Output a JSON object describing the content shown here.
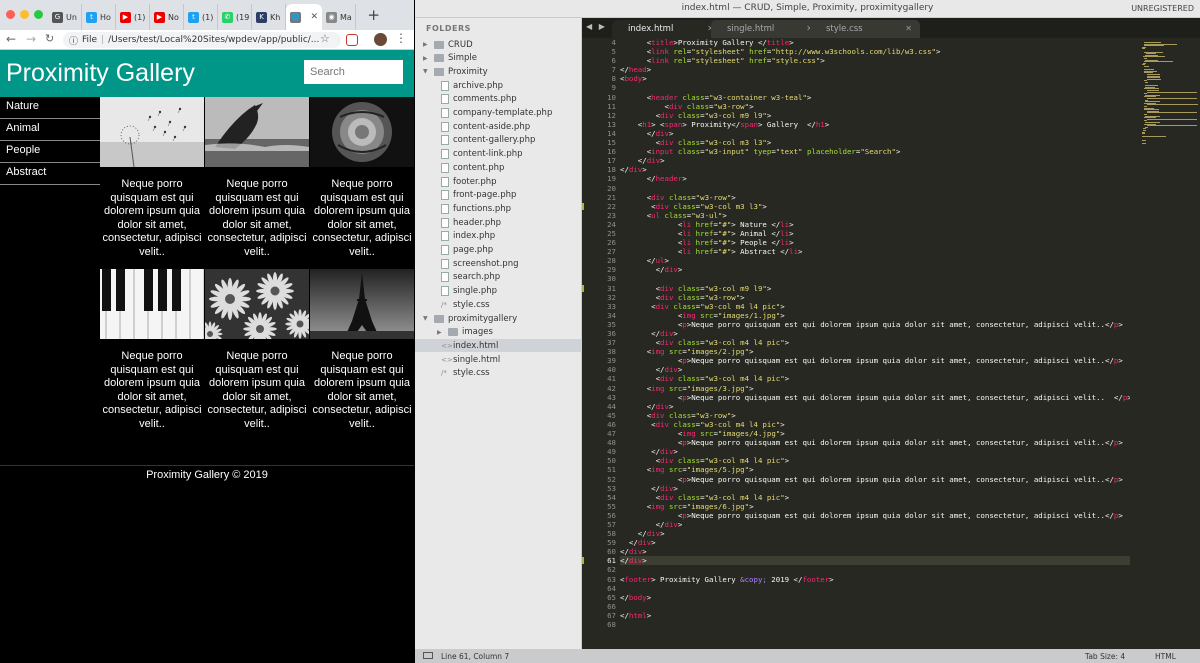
{
  "browser": {
    "tabs": [
      {
        "label": "Un",
        "icon": "G",
        "color": "#555"
      },
      {
        "label": "Ho",
        "icon": "t",
        "color": "#1da1f2"
      },
      {
        "label": "(1)",
        "icon": "▶",
        "color": "#e00"
      },
      {
        "label": "No",
        "icon": "▶",
        "color": "#e00"
      },
      {
        "label": "(1)",
        "icon": "t",
        "color": "#1da1f2"
      },
      {
        "label": "(19",
        "icon": "✆",
        "color": "#25d366"
      },
      {
        "label": "Kh",
        "icon": "K",
        "color": "#2b3e66"
      }
    ],
    "active_tab_icon": "globe-icon",
    "last_tab": {
      "label": "Ma",
      "icon": "◉",
      "color": "#888"
    },
    "new_tab": "+",
    "address_scheme": "File",
    "address": "/Users/test/Local%20Sites/wpdev/app/public/..."
  },
  "site": {
    "title": "Proximity Gallery",
    "search_placeholder": "Search",
    "nav": [
      "Nature",
      "Animal",
      "People",
      "Abstract"
    ],
    "caption": "Neque porro quisquam est qui dolorem ipsum quia dolor sit amet, consectetur, adipisci velit..",
    "images": [
      "dandelion",
      "dolphin",
      "rose",
      "piano",
      "daisies",
      "eiffel-tower"
    ],
    "footer": "Proximity Gallery © 2019"
  },
  "editor": {
    "title": "index.html — CRUD, Simple, Proximity, proximitygallery",
    "unregistered": "UNREGISTERED",
    "folders_label": "FOLDERS",
    "tree": [
      {
        "type": "folder",
        "label": "CRUD",
        "open": false,
        "depth": 0
      },
      {
        "type": "folder",
        "label": "Simple",
        "open": false,
        "depth": 0
      },
      {
        "type": "folder",
        "label": "Proximity",
        "open": true,
        "depth": 0
      },
      {
        "type": "file",
        "label": "archive.php",
        "depth": 1
      },
      {
        "type": "file",
        "label": "comments.php",
        "depth": 1
      },
      {
        "type": "file",
        "label": "company-template.php",
        "depth": 1
      },
      {
        "type": "file",
        "label": "content-aside.php",
        "depth": 1
      },
      {
        "type": "file",
        "label": "content-gallery.php",
        "depth": 1
      },
      {
        "type": "file",
        "label": "content-link.php",
        "depth": 1
      },
      {
        "type": "file",
        "label": "content.php",
        "depth": 1
      },
      {
        "type": "file",
        "label": "footer.php",
        "depth": 1
      },
      {
        "type": "file",
        "label": "front-page.php",
        "depth": 1
      },
      {
        "type": "file",
        "label": "functions.php",
        "depth": 1
      },
      {
        "type": "file",
        "label": "header.php",
        "depth": 1
      },
      {
        "type": "file",
        "label": "index.php",
        "depth": 1
      },
      {
        "type": "file",
        "label": "page.php",
        "depth": 1
      },
      {
        "type": "file",
        "label": "screenshot.png",
        "depth": 1
      },
      {
        "type": "file",
        "label": "search.php",
        "depth": 1
      },
      {
        "type": "file",
        "label": "single.php",
        "depth": 1
      },
      {
        "type": "css",
        "label": "style.css",
        "depth": 1
      },
      {
        "type": "folder",
        "label": "proximitygallery",
        "open": true,
        "depth": 0
      },
      {
        "type": "folder",
        "label": "images",
        "open": false,
        "depth": 1
      },
      {
        "type": "html",
        "label": "index.html",
        "depth": 1,
        "selected": true
      },
      {
        "type": "html",
        "label": "single.html",
        "depth": 1
      },
      {
        "type": "css",
        "label": "style.css",
        "depth": 1
      }
    ],
    "tabs": [
      {
        "label": "index.html",
        "active": true
      },
      {
        "label": "single.html",
        "active": false
      },
      {
        "label": "style.css",
        "active": false
      }
    ],
    "first_line_number": 4,
    "current_line": 61,
    "modified_lines": [
      22,
      31,
      61
    ],
    "code_lines": [
      "      <title>Proximity Gallery </title>",
      "      <link rel=\"stylesheet\" href=\"http://www.w3schools.com/lib/w3.css\">",
      "      <link rel=\"stylesheet\" href=\"style.css\">",
      "</head>",
      "<body>",
      "",
      "      <header class=\"w3-container w3-teal\">",
      "          <div class=\"w3-row\">",
      "        <div class=\"w3-col m9 l9\">",
      "    <h1> <span> Proximity</span> Gallery  </h1>",
      "      </div>",
      "        <div class=\"w3-col m3 l3\">",
      "      <input class=\"w3-input\" tyep=\"text\" placeholder=\"Search\">",
      "    </div>",
      "</div>",
      "      </header>",
      "",
      "      <div class=\"w3-row\">",
      "       <div class=\"w3-col m3 l3\">",
      "      <ul class=\"w3-ul\">",
      "             <li href=\"#\"> Nature </li>",
      "             <li href=\"#\"> Animal </li>",
      "             <li href=\"#\"> People </li>",
      "             <li href=\"#\"> Abstract </li>",
      "      </ul>",
      "        </div>",
      "",
      "        <div class=\"w3-col m9 l9\">",
      "        <div class=\"w3-row\">",
      "       <div class=\"w3-col m4 l4 pic\">",
      "             <img src=\"images/1.jpg\">",
      "             <p>Neque porro quisquam est qui dolorem ipsum quia dolor sit amet, consectetur, adipisci velit..</p>",
      "       </div>",
      "        <div class=\"w3-col m4 l4 pic\">",
      "      <img src=\"images/2.jpg\">",
      "             <p>Neque porro quisquam est qui dolorem ipsum quia dolor sit amet, consectetur, adipisci velit..</p>",
      "        </div>",
      "        <div class=\"w3-col m4 l4 pic\">",
      "      <img src=\"images/3.jpg\">",
      "             <p>Neque porro quisquam est qui dolorem ipsum quia dolor sit amet, consectetur, adipisci velit..  </p>",
      "      </div>",
      "      <div class=\"w3-row\">",
      "       <div class=\"w3-col m4 l4 pic\">",
      "             <img src=\"images/4.jpg\">",
      "             <p>Neque porro quisquam est qui dolorem ipsum quia dolor sit amet, consectetur, adipisci velit..</p>",
      "       </div>",
      "        <div class=\"w3-col m4 l4 pic\">",
      "      <img src=\"images/5.jpg\">",
      "             <p>Neque porro quisquam est qui dolorem ipsum quia dolor sit amet, consectetur, adipisci velit..</p>",
      "       </div>",
      "        <div class=\"w3-col m4 l4 pic\">",
      "      <img src=\"images/6.jpg\">",
      "             <p>Neque porro quisquam est qui dolorem ipsum quia dolor sit amet, consectetur, adipisci velit..</p>",
      "        </div>",
      "    </div>",
      "  </div>",
      "</div>",
      "</div>",
      "",
      "<footer> Proximity Gallery &copy; 2019 </footer>",
      "",
      "</body>",
      "",
      "</html>",
      ""
    ],
    "status": {
      "position": "Line 61, Column 7",
      "tab_size": "Tab Size: 4",
      "syntax": "HTML"
    }
  },
  "colors": {
    "teal": "#009688",
    "editor_bg": "#272822",
    "tag": "#f92672",
    "attr": "#a6e22e",
    "string": "#e6db74",
    "entity": "#ae81ff"
  }
}
